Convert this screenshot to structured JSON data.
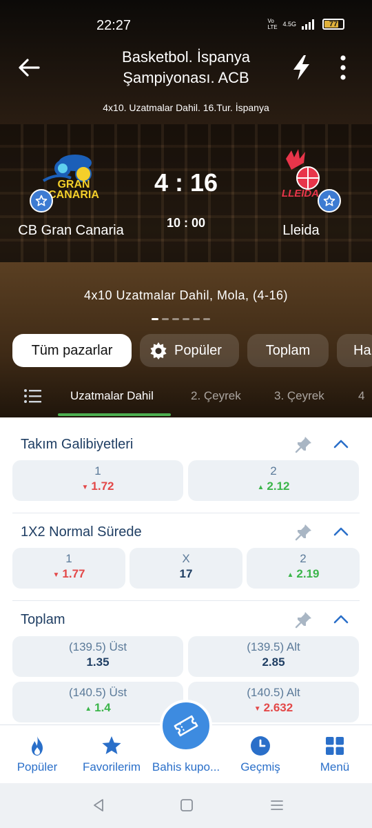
{
  "status_bar": {
    "time": "22:27",
    "network": "4.5G",
    "volte": "Vo LTE",
    "battery": "77",
    "battery_level": 0.77
  },
  "header": {
    "title": "Basketbol. İspanya Şampiyonası. ACB",
    "subtitle": "4x10. Uzatmalar Dahil. 16.Tur. İspanya",
    "back_icon": "arrow-left-icon",
    "bolt_icon": "lightning-icon",
    "more_icon": "more-vertical-icon"
  },
  "match": {
    "home": {
      "name": "CB Gran Canaria",
      "logo_text": "GRAN CANARIA"
    },
    "away": {
      "name": "Lleida",
      "logo_text": "LLEIDA"
    },
    "score": "4 : 16",
    "clock": "10 : 00",
    "period_info": "4x10 Uzatmalar Dahil, Mola, (4-16)"
  },
  "market_pills": [
    {
      "label": "Tüm pazarlar",
      "active": true
    },
    {
      "label": "Popüler",
      "icon": "gear-icon"
    },
    {
      "label": "Toplam"
    },
    {
      "label": "Ha"
    }
  ],
  "subtabs": [
    {
      "label": "Uzatmalar Dahil",
      "active": true
    },
    {
      "label": "2. Çeyrek"
    },
    {
      "label": "3. Çeyrek"
    },
    {
      "label": "4"
    }
  ],
  "sections": [
    {
      "title": "Takım Galibiyetleri",
      "odds": [
        {
          "label": "1",
          "value": "1.72",
          "trend": "down"
        },
        {
          "label": "2",
          "value": "2.12",
          "trend": "up"
        }
      ]
    },
    {
      "title": "1X2 Normal Sürede",
      "odds": [
        {
          "label": "1",
          "value": "1.77",
          "trend": "down"
        },
        {
          "label": "X",
          "value": "17",
          "trend": "none"
        },
        {
          "label": "2",
          "value": "2.19",
          "trend": "up"
        }
      ]
    },
    {
      "title": "Toplam",
      "odds": [
        {
          "label": "(139.5) Üst",
          "value": "1.35",
          "trend": "none"
        },
        {
          "label": "(139.5) Alt",
          "value": "2.85",
          "trend": "none"
        },
        {
          "label": "(140.5) Üst",
          "value": "1.4",
          "trend": "up"
        },
        {
          "label": "(140.5) Alt",
          "value": "2.632",
          "trend": "down"
        }
      ]
    }
  ],
  "bottom_nav": [
    {
      "label": "Popüler",
      "icon": "flame-icon"
    },
    {
      "label": "Favorilerim",
      "icon": "star-icon"
    },
    {
      "label": "Bahis kupo...",
      "icon": "ticket-icon"
    },
    {
      "label": "Geçmiş",
      "icon": "clock-icon"
    },
    {
      "label": "Menü",
      "icon": "grid-icon"
    }
  ],
  "colors": {
    "accent_blue": "#3d8be0",
    "title_navy": "#1f3e63",
    "down_red": "#e34848",
    "up_green": "#3bb54a",
    "tab_underline": "#4caf50"
  }
}
